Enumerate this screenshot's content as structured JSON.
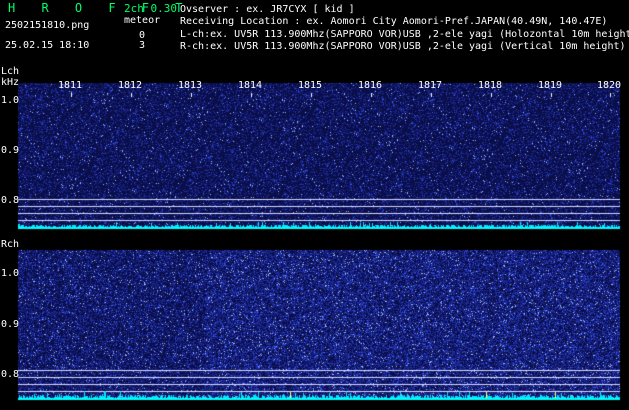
{
  "header": {
    "title": "H R O F F T",
    "version": "2ch 0.30",
    "filename": "2502151810.png",
    "datetime": "25.02.15 18:10",
    "meteor_label": "meteor",
    "meteor_count_l": "0",
    "meteor_count_r": "3"
  },
  "info": {
    "line1": "Ovserver           : ex. JR7CYX [ kid ]",
    "line2": "Receiving Location : ex. Aomori City Aomori-Pref.JAPAN(40.49N, 140.47E)",
    "line3": "L-ch:ex. UV5R 113.900Mhz(SAPPORO VOR)USB ,2-ele yagi (Holozontal 10m height)",
    "line4": "R-ch:ex. UV5R 113.900Mhz(SAPPORO VOR)USB ,2-ele yagi (Vertical 10m height)"
  },
  "axes": {
    "lch_label": "Lch",
    "khz_label": "kHz",
    "rch_label": "Rch",
    "time_ticks": [
      "1811",
      "1812",
      "1813",
      "1814",
      "1815",
      "1816",
      "1817",
      "1818",
      "1819",
      "1820"
    ],
    "freq_ticks_l": [
      "1.0",
      "0.9",
      "0.8"
    ],
    "freq_ticks_r": [
      "1.0",
      "0.9",
      "0.8"
    ]
  },
  "colors": {
    "background": "#000000",
    "title_green": "#00ff6a",
    "spectrum_blue": "#1a2a9c",
    "signal_cyan": "#00ffff",
    "grid_lines": "#d0d0ff"
  }
}
